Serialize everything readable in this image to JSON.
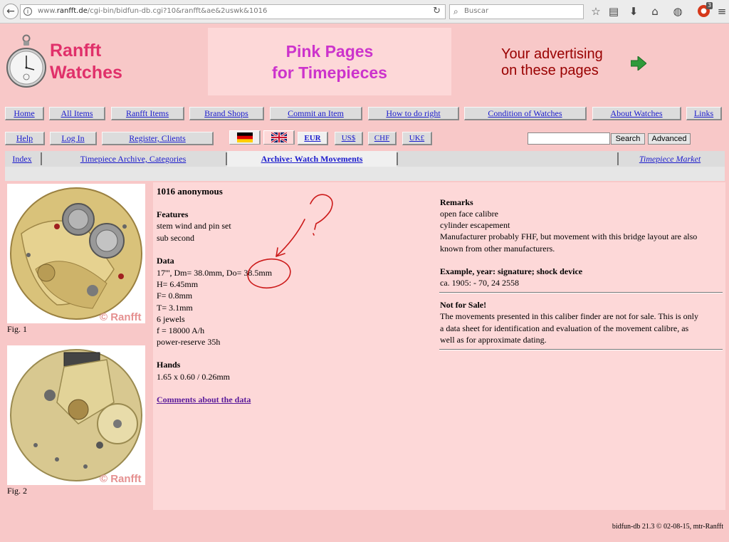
{
  "browser": {
    "url_prefix": "www.",
    "url_domain": "ranfft.de",
    "url_path": "/cgi-bin/bidfun-db.cgi?10&ranfft&ae&2uswk&1016",
    "search_placeholder": "Buscar",
    "ext_badge": "3"
  },
  "header": {
    "logo_line1": "Ranfft",
    "logo_line2": "Watches",
    "pink_line1": "Pink Pages",
    "pink_line2": "for Timepieces",
    "advert_line1": "Your advertising",
    "advert_line2": "on these pages"
  },
  "nav": {
    "home": "Home",
    "all_items": "All Items",
    "ranfft_items": "Ranfft Items",
    "brand_shops": "Brand Shops",
    "commit_item": "Commit an Item",
    "how_to": "How to do right",
    "condition": "Condition of Watches",
    "about": "About Watches",
    "links": "Links"
  },
  "nav2": {
    "help": "Help",
    "login": "Log In",
    "register": "Register, Clients",
    "eur": "EUR",
    "usd": "US$",
    "chf": "CHF",
    "gbp": "UK£",
    "search_button": "Search",
    "advanced_button": "Advanced"
  },
  "subnav": {
    "index": "Index",
    "archive_categories": "Timepiece Archive, Categories",
    "archive_movements": "Archive: Watch Movements",
    "market": "Timepiece Market"
  },
  "figures": {
    "fig1": "Fig. 1",
    "fig2": "Fig. 2",
    "watermark": "© Ranfft"
  },
  "movement": {
    "title": "1016 anonymous",
    "features_heading": "Features",
    "features": [
      "stem wind and pin set",
      "sub second"
    ],
    "data_heading": "Data",
    "data_line1": "17''', Dm= 38.0mm, Do= 38.5mm",
    "data": [
      "H= 6.45mm",
      "F= 0.8mm",
      "T= 3.1mm",
      "6 jewels",
      "f = 18000 A/h",
      "power-reserve 35h"
    ],
    "hands_heading": "Hands",
    "hands": "1.65 x 0.60 / 0.26mm",
    "comments_link": "Comments about the data"
  },
  "remarks": {
    "heading": "Remarks",
    "line1": "open face calibre",
    "line2": "cylinder escapement",
    "line3": "Manufacturer probably FHF, but movement with this bridge layout are also",
    "line4": "known from other manufacturers.",
    "example_heading": "Example, year: signature; shock device",
    "example": "ca. 1905: - 70, 24 2558",
    "notforsale_heading": "Not for Sale!",
    "nfs1": "The movements presented in this caliber finder are not for sale. This is only",
    "nfs2": "a data sheet for identification and evaluation of the movement calibre, as",
    "nfs3": "well as for approximate dating."
  },
  "footer": "bidfun-db 21.3 © 02-08-15, mtr-Ranfft",
  "colors": {
    "page_bg": "#f8c8c8",
    "panel_bg": "#fdd8d8",
    "logo_pink": "#e0306a",
    "pink_pages": "#cc33cc",
    "advert": "#990000",
    "link": "#1a1acc",
    "annotation": "#cc1a1a"
  }
}
